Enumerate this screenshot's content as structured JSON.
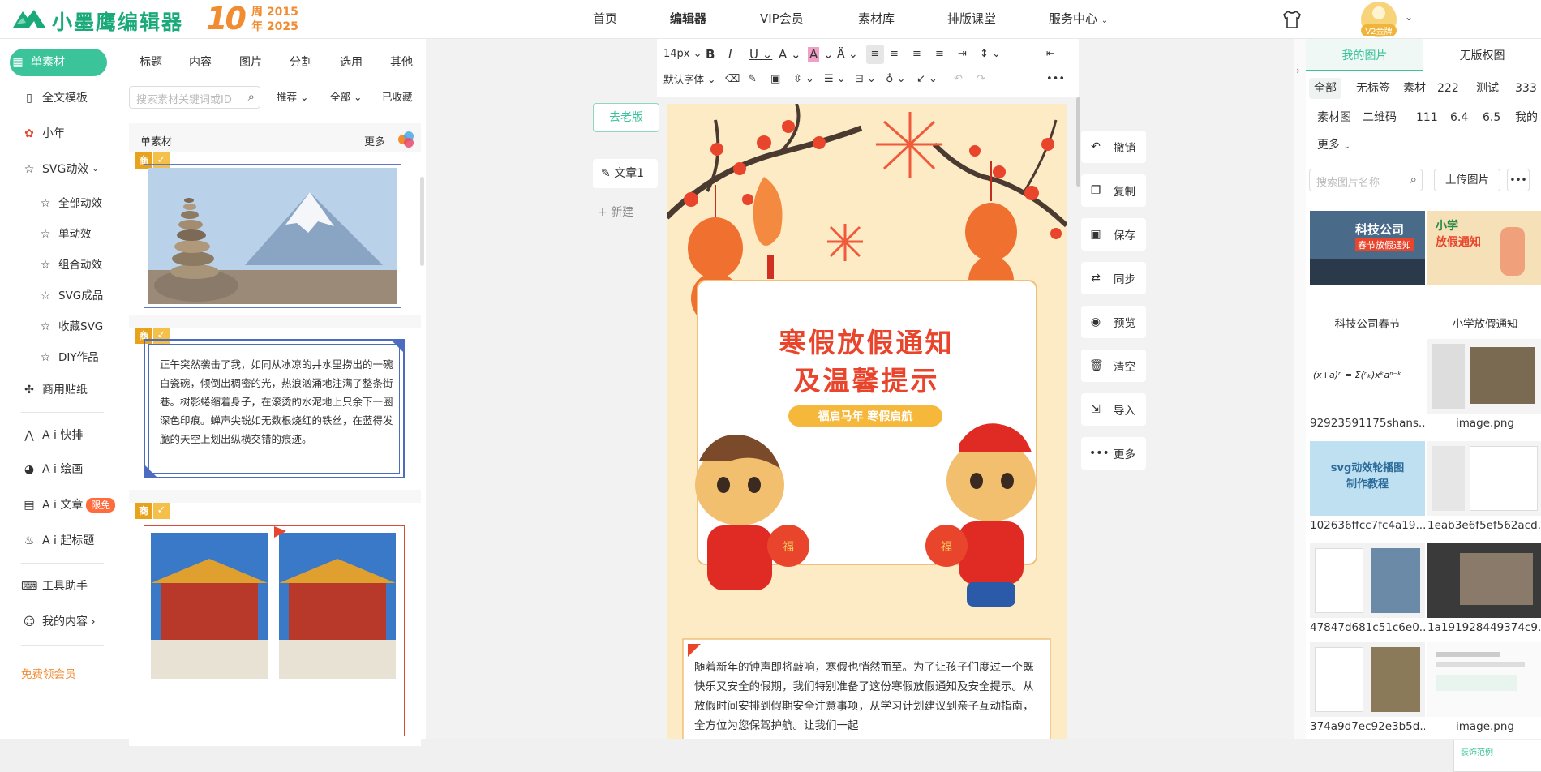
{
  "header": {
    "brand": "小墨鹰编辑器",
    "anniversary_num": "10",
    "anniversary_line1": "周 2015",
    "anniversary_line2": "年 2025",
    "nav": [
      "首页",
      "编辑器",
      "VIP会员",
      "素材库",
      "排版课堂",
      "服务中心"
    ],
    "vip_badge": "V2金牌"
  },
  "sidebar": {
    "items": [
      "单素材",
      "全文模板",
      "小年",
      "SVG动效"
    ],
    "svg_sub": [
      "全部动效",
      "单动效",
      "组合动效",
      "SVG成品",
      "收藏SVG",
      "DIY作品"
    ],
    "items2": [
      "商用贴纸",
      "A i 快排",
      "A i 绘画",
      "A i 文章",
      "A i 起标题"
    ],
    "ai_badge": "限免",
    "tools": "工具助手",
    "mine": "我的内容",
    "free_vip": "免费领会员"
  },
  "materials": {
    "tabs": [
      "标题",
      "内容",
      "图片",
      "分割",
      "选用",
      "其他"
    ],
    "search_placeholder": "搜索素材关键词或ID",
    "sort": "推荐",
    "filter": "全部",
    "favorited": "已收藏",
    "section": "单素材",
    "more": "更多",
    "badge_shang": "商",
    "card_text": "正午突然袭击了我，如同从冰凉的井水里捞出的一碗白瓷碗，倾倒出稠密的光，热浪汹涌地注满了整条街巷。树影蜷缩着身子，在滚烫的水泥地上只余下一圈深色印痕。蝉声尖锐如无数根烧红的铁丝，在蓝得发脆的天空上划出纵横交错的痕迹。"
  },
  "editor": {
    "old_version": "去老版",
    "doc_tab": "文章1",
    "new_tab": "新建",
    "font_size": "14px",
    "default_font": "默认字体",
    "paper_title1": "寒假放假通知",
    "paper_title2": "及温馨提示",
    "paper_ribbon": "福启马年  寒假启航",
    "lantern_char": "福",
    "paper_body": "随着新年的钟声即将敲响，寒假也悄然而至。为了让孩子们度过一个既快乐又安全的假期，我们特别准备了这份寒假放假通知及安全提示。从放假时间安排到假期安全注意事项，从学习计划建议到亲子互动指南，全方位为您保驾护航。让我们一起"
  },
  "actions": [
    "撤销",
    "复制",
    "保存",
    "同步",
    "预览",
    "清空",
    "导入",
    "更多"
  ],
  "images": {
    "tabs": [
      "我的图片",
      "无版权图"
    ],
    "tags_row1": [
      "全部",
      "无标签",
      "素材",
      "222",
      "测试",
      "333"
    ],
    "tags_row2": [
      "素材图",
      "二维码",
      "111",
      "6.4",
      "6.5",
      "我的"
    ],
    "more": "更多",
    "search_placeholder": "搜索图片名称",
    "upload": "上传图片",
    "thumb_text1": "科技公司",
    "thumb_text1b": "春节放假通知",
    "thumb_text2": "小学",
    "thumb_text2b": "放假通知",
    "thumb_text5": "svg动效轮播图",
    "thumb_text5b": "制作教程",
    "thumb_formula": "(x+a)ⁿ = Σ(ⁿₖ)xᵏaⁿ⁻ᵏ",
    "thumb_mini_label": "装饰范例",
    "names": [
      "科技公司春节",
      "小学放假通知",
      "92923591175shans...",
      "image.png",
      "102636ffcc7fc4a19...",
      "1eab3e6f5ef562acd...",
      "47847d681c51c6e0...",
      "1a191928449374c9...",
      "374a9d7ec92e3b5d...",
      "image.png"
    ]
  },
  "colors": {
    "accent": "#3bc49a",
    "brand": "#1aaa7a",
    "anniversary": "#f28c30",
    "title_red": "#e8452c"
  }
}
